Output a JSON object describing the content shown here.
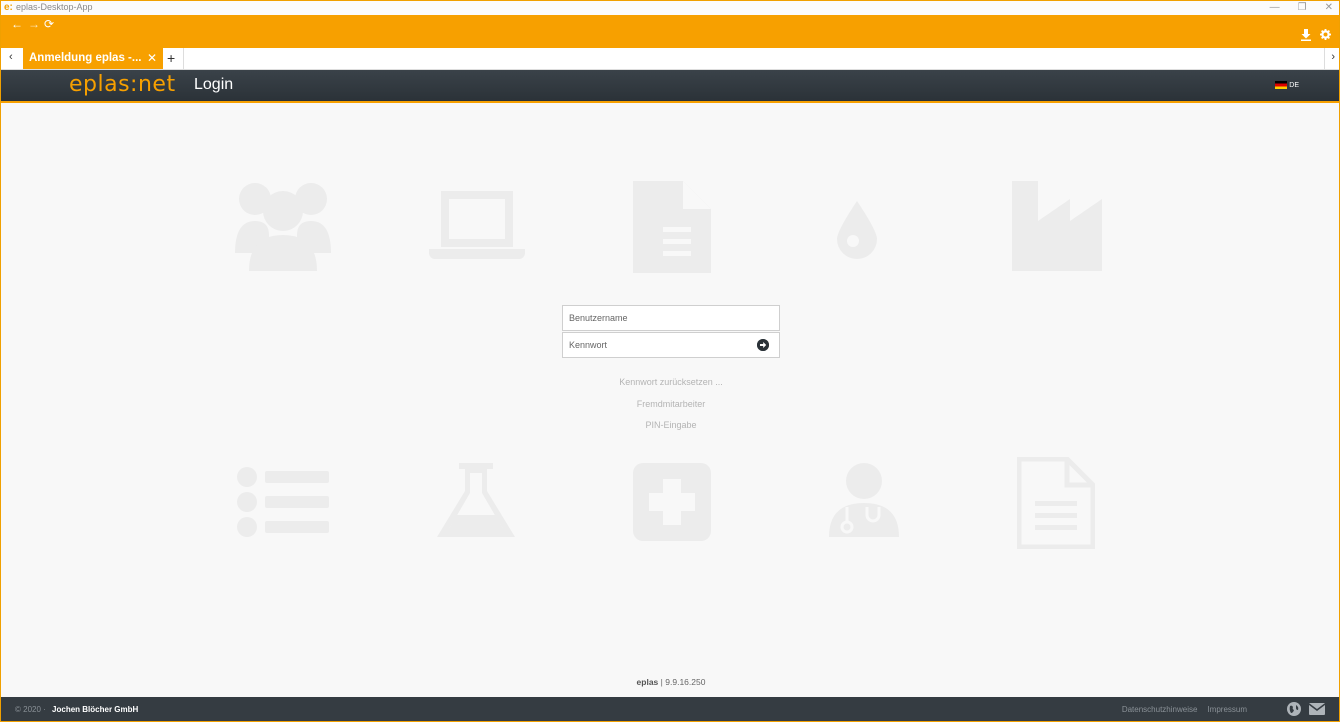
{
  "window": {
    "app_icon_text": "e:",
    "title": "eplas-Desktop-App",
    "controls": {
      "minimize": "—",
      "restore": "❐",
      "close": "✕"
    }
  },
  "nav": {
    "back": "←",
    "forward": "→",
    "reload": "⟳",
    "download_icon": "download-icon",
    "settings_icon": "gear-icon"
  },
  "tabs": {
    "scroll_left": "‹",
    "scroll_right": "›",
    "active_tab": {
      "label": "Anmeldung eplas -...",
      "close": "✕"
    },
    "add": "+"
  },
  "header": {
    "logo": "eplas:net",
    "title": "Login",
    "language": "DE"
  },
  "login": {
    "username_placeholder": "Benutzername",
    "password_placeholder": "Kennwort",
    "submit_icon": "arrow-circle-right-icon"
  },
  "links": {
    "reset_password": "Kennwort zurücksetzen ...",
    "external_staff": "Fremdmitarbeiter",
    "pin_entry": "PIN-Eingabe"
  },
  "version": {
    "product": "eplas",
    "separator": "|",
    "number": "9.9.16.250"
  },
  "footer": {
    "copyright": "© 2020 ·",
    "company": "Jochen Blöcher GmbH",
    "privacy": "Datenschutzhinweise",
    "imprint": "Impressum",
    "globe_icon": "globe-icon",
    "mail_icon": "mail-icon"
  },
  "colors": {
    "accent": "#f7a000",
    "header_bg": "#2b3238",
    "footer_bg": "#353c42",
    "background": "#f8f8f8",
    "watermark_icon": "#ececec"
  },
  "background_icons": [
    "users-icon",
    "laptop-icon",
    "document-icon",
    "drop-icon",
    "factory-icon",
    "list-icon",
    "flask-icon",
    "medical-plus-icon",
    "doctor-icon",
    "file-text-icon"
  ]
}
